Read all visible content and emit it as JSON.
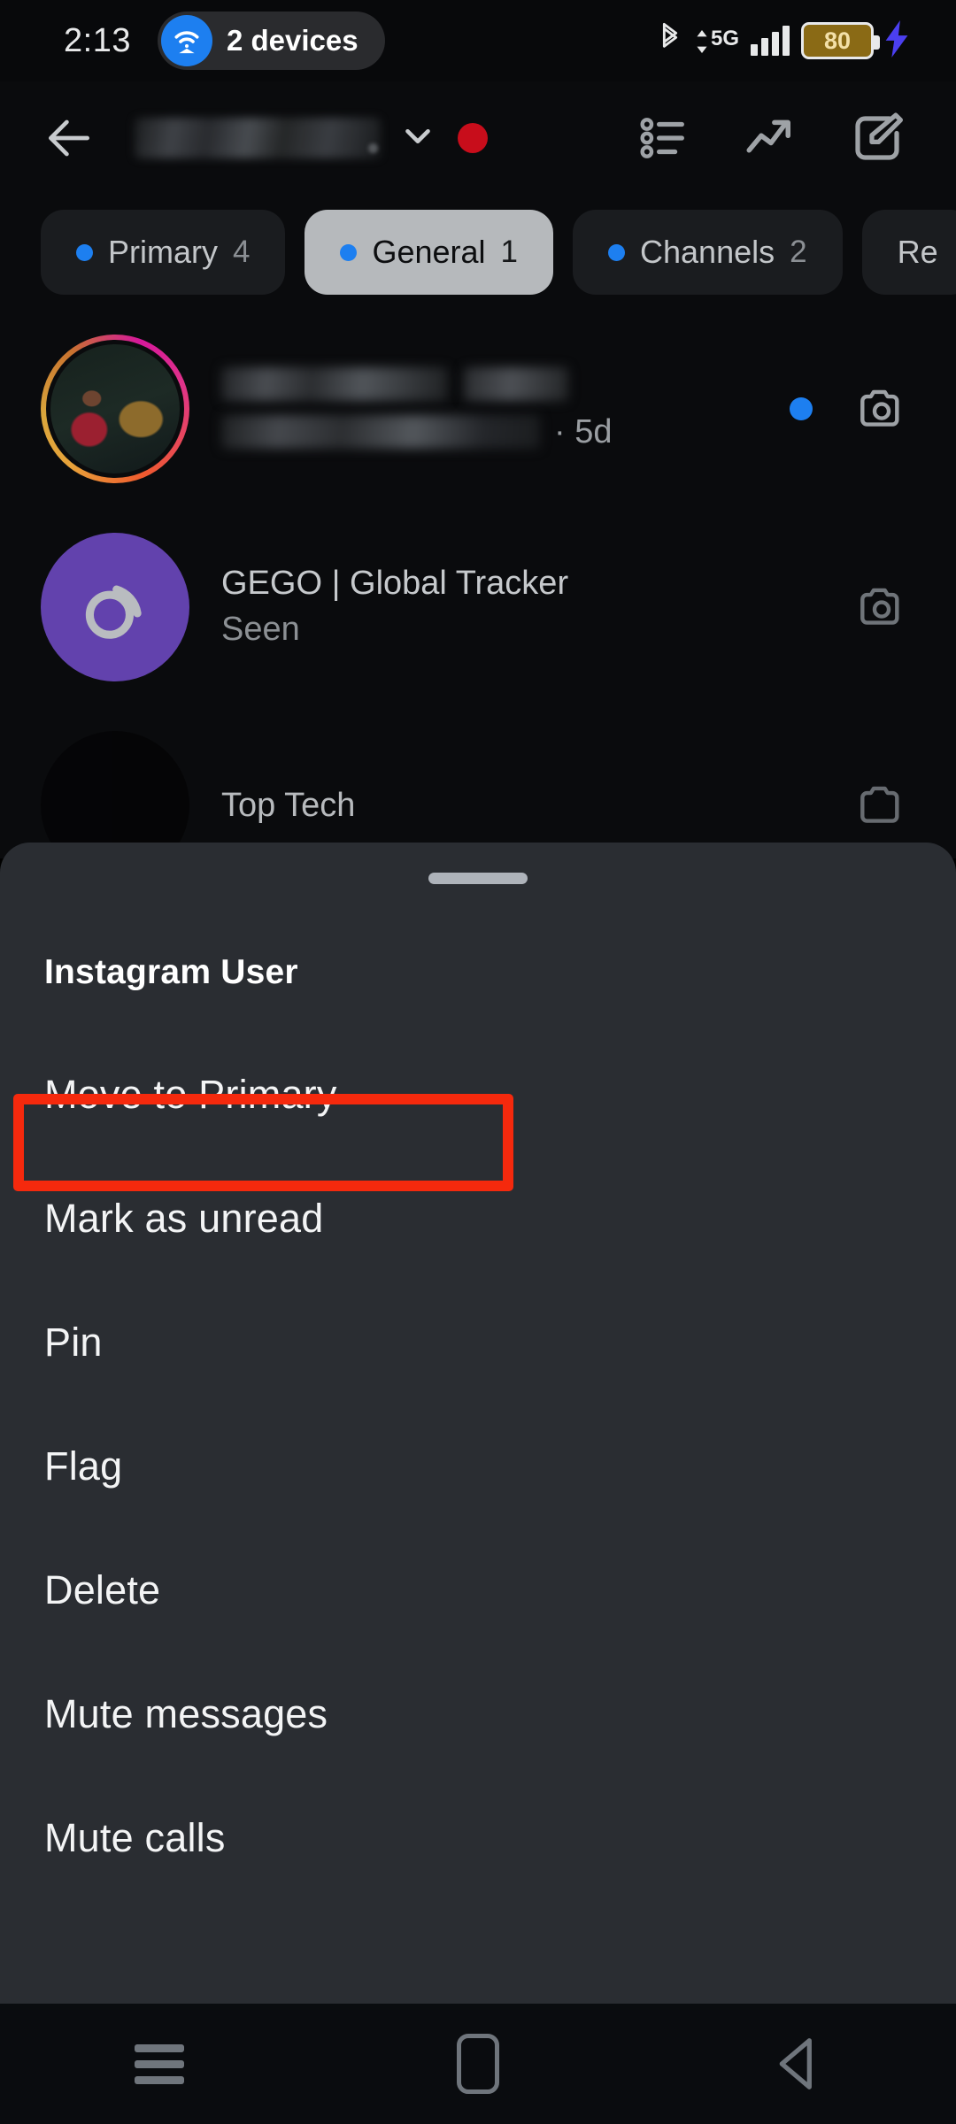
{
  "status_bar": {
    "clock": "2:13",
    "hotspot_chip_label": "2 devices",
    "hotspot_icon": "wifi-hotspot-icon",
    "bluetooth_icon": "bluetooth-icon",
    "network_type": "5G",
    "data_arrows_icon": "data-transfer-arrows-icon",
    "signal_icon": "signal-bars-icon",
    "battery_percent": "80",
    "charging_icon": "charging-bolt-icon",
    "colors": {
      "accent_blue": "#1d7ff0",
      "battery_amber": "#8a6a15",
      "bolt_purple": "#4b3ff0"
    }
  },
  "header": {
    "back_icon": "back-arrow-icon",
    "username_redacted": "",
    "chevron_icon": "chevron-down-icon",
    "notification_dot": "red-dot-badge",
    "notification_dot_color": "#c80d1b",
    "actions": [
      {
        "name": "list-icon",
        "label": ""
      },
      {
        "name": "trending-up-icon",
        "label": ""
      },
      {
        "name": "compose-edit-icon",
        "label": ""
      }
    ]
  },
  "tabs": [
    {
      "label": "Primary",
      "count": "4",
      "active": false
    },
    {
      "label": "General",
      "count": "1",
      "active": true
    },
    {
      "label": "Channels",
      "count": "2",
      "active": false
    },
    {
      "label": "Re",
      "count": "",
      "active": false
    }
  ],
  "chat_list": [
    {
      "avatar": "story-ring-photo-avatar",
      "name_redacted": "",
      "preview_redacted": "",
      "separator": "·",
      "time": "5d",
      "unread": true,
      "camera_icon": "camera-icon"
    },
    {
      "avatar": "purple-spiral-logo-avatar",
      "name": "GEGO | Global Tracker",
      "preview": "Seen",
      "unread": false,
      "camera_icon": "camera-icon"
    },
    {
      "avatar": "dark-avatar",
      "name": "Top Tech",
      "preview": "",
      "unread": false,
      "camera_icon": "camera-icon"
    }
  ],
  "sheet": {
    "handle": "drag-handle",
    "title": "Instagram User",
    "highlight_color": "#f5290d",
    "items": [
      {
        "label": "Move to Primary",
        "highlighted": true
      },
      {
        "label": "Mark as unread",
        "highlighted": false
      },
      {
        "label": "Pin",
        "highlighted": false
      },
      {
        "label": "Flag",
        "highlighted": false
      },
      {
        "label": "Delete",
        "highlighted": false
      },
      {
        "label": "Mute messages",
        "highlighted": false
      },
      {
        "label": "Mute calls",
        "highlighted": false
      }
    ]
  },
  "nav_bar": {
    "recents_icon": "hamburger-recents-icon",
    "home_icon": "home-square-icon",
    "back_icon": "back-triangle-icon"
  }
}
